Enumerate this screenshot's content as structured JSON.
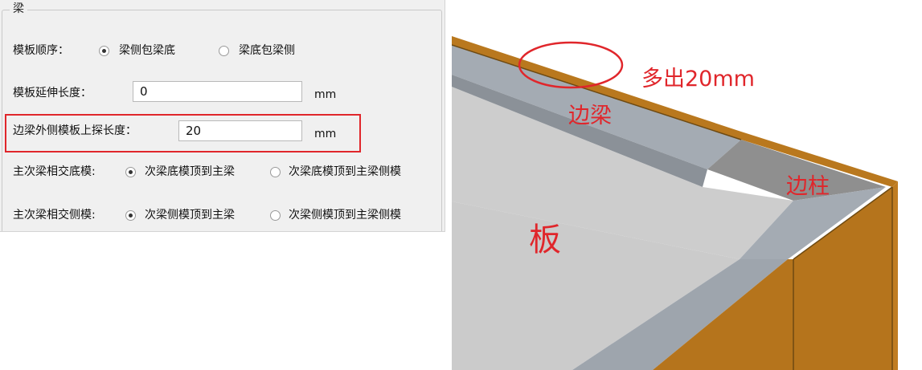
{
  "group": {
    "title": "梁"
  },
  "formwork_order": {
    "label": "模板顺序：",
    "options": [
      "梁侧包梁底",
      "梁底包梁侧"
    ],
    "selected_index": 0
  },
  "extension_length": {
    "label": "模板延伸长度：",
    "value": "0",
    "unit": "mm"
  },
  "edge_beam_protrude": {
    "label": "边梁外侧模板上探长度：",
    "value": "20",
    "unit": "mm"
  },
  "main_sec_bottom": {
    "label": "主次梁相交底模:",
    "options": [
      "次梁底模顶到主梁",
      "次梁底模顶到主梁侧模"
    ],
    "selected_index": 0
  },
  "main_sec_side": {
    "label": "主次梁相交侧模:",
    "options": [
      "次梁侧模顶到主梁",
      "次梁侧模顶到主梁侧模"
    ],
    "selected_index": 0
  },
  "annotations": {
    "extra": "多出20mm",
    "edge_beam": "边梁",
    "edge_column": "边柱",
    "slab": "板"
  },
  "colors": {
    "accent_red": "#e0262b",
    "slab": "#cdcdcd",
    "beam": "#a4abb3",
    "column": "#8c8c8c",
    "formwork_wood": "#b9781e"
  }
}
